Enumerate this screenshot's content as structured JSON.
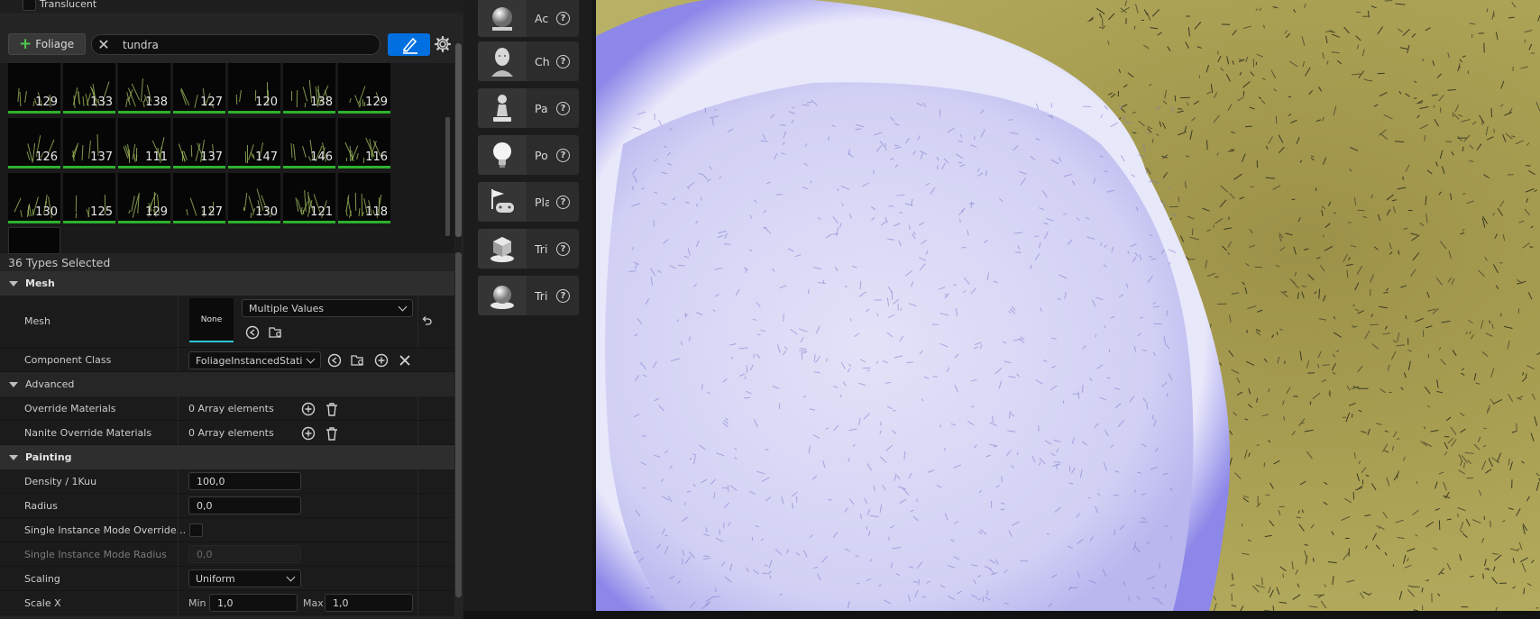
{
  "foliage_panel": {
    "translucent_label": "Translucent",
    "add_foliage_label": "Foliage",
    "search_value": "tundra",
    "thumbnails": [
      [
        "129",
        "133",
        "138",
        "127",
        "120",
        "138",
        "129"
      ],
      [
        "126",
        "137",
        "111",
        "137",
        "147",
        "146",
        "116"
      ],
      [
        "130",
        "125",
        "129",
        "127",
        "130",
        "121",
        "118"
      ]
    ],
    "types_selected": "36 Types Selected"
  },
  "details": {
    "mesh_category": "Mesh",
    "mesh_label": "Mesh",
    "mesh_thumb_text": "None",
    "mesh_value": "Multiple Values",
    "component_class_label": "Component Class",
    "component_class_value": "FoliageInstancedStatic",
    "advanced_category": "Advanced",
    "override_materials_label": "Override Materials",
    "override_materials_value": "0 Array elements",
    "nanite_override_label": "Nanite Override Materials",
    "nanite_override_value": "0 Array elements",
    "painting_category": "Painting",
    "density_label": "Density / 1Kuu",
    "density_value": "100,0",
    "radius_label": "Radius",
    "radius_value": "0,0",
    "single_override_label": "Single Instance Mode Override...",
    "single_radius_label": "Single Instance Mode Radius",
    "single_radius_value": "0,0",
    "scaling_label": "Scaling",
    "scaling_value": "Uniform",
    "scalex_label": "Scale X",
    "min_label": "Min",
    "min_value": "1,0",
    "max_label": "Max",
    "max_value": "1,0"
  },
  "place_actors": [
    {
      "label": "Ac",
      "icon": "sphere-actor-icon"
    },
    {
      "label": "Ch",
      "icon": "character-icon"
    },
    {
      "label": "Pa",
      "icon": "pawn-icon"
    },
    {
      "label": "Po",
      "icon": "point-light-icon"
    },
    {
      "label": "Pla",
      "icon": "player-start-icon"
    },
    {
      "label": "Tri",
      "icon": "trigger-box-icon"
    },
    {
      "label": "Tri",
      "icon": "trigger-sphere-icon"
    }
  ],
  "colors": {
    "accent_blue": "#0070e0",
    "ground": "#a9a053",
    "brush_sphere": "#cfcdf6",
    "selection_green": "#2db22d"
  }
}
